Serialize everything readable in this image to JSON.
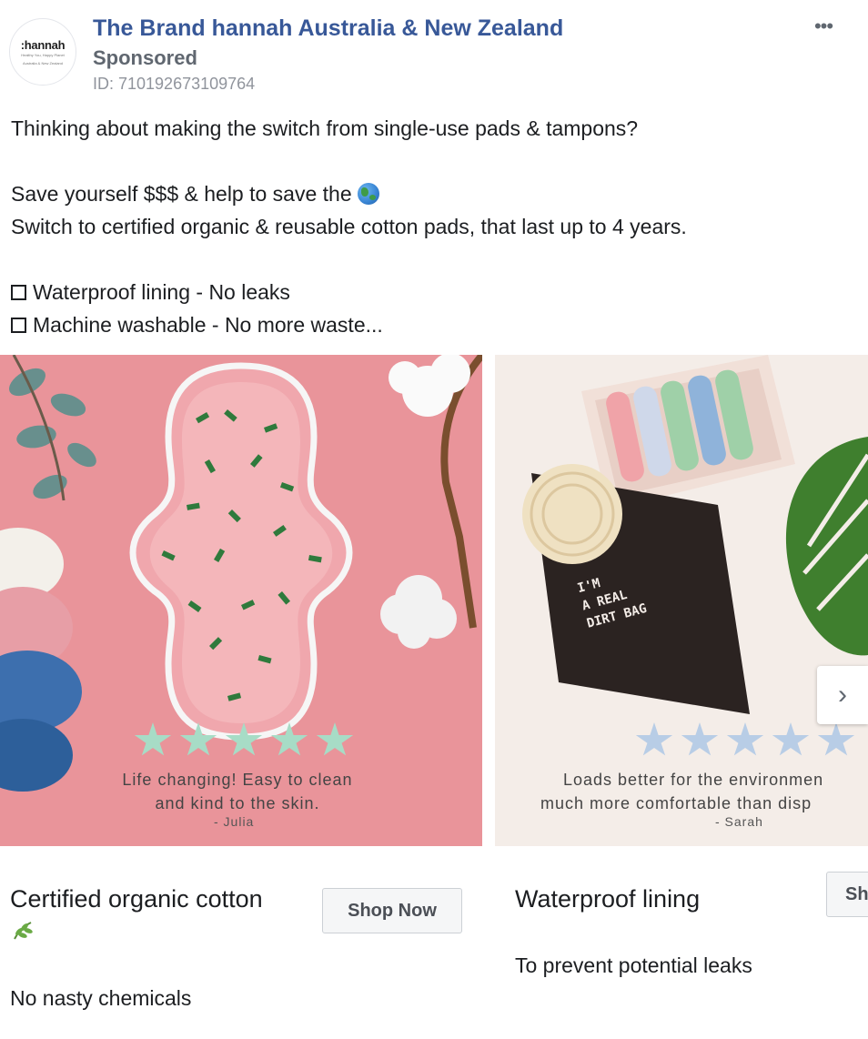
{
  "header": {
    "avatar_brand": ":hannah",
    "avatar_tagline": "Healthy You, Happy Planet",
    "avatar_region": "Australia & New Zealand",
    "page_name": "The Brand hannah Australia & New Zealand",
    "sponsored": "Sponsored",
    "ad_id": "ID: 710192673109764",
    "more_label": "•••"
  },
  "post": {
    "line1": "Thinking about making the switch from single-use pads & tampons?",
    "line2": "Save yourself $$$ & help to save the",
    "line2_icon": "globe-icon",
    "line3": "Switch to certified organic & reusable cotton pads, that last up to 4 years.",
    "bullet1": "Waterproof lining - No leaks",
    "bullet2": "Machine washable - No more waste..."
  },
  "carousel": {
    "cards": [
      {
        "quote_line1": "Life changing! Easy to clean",
        "quote_line2": "and kind to the skin.",
        "author": "- Julia",
        "rating": 5,
        "headline": "Certified organic cotton",
        "headline_icon": "leaf-icon",
        "description": "No nasty chemicals",
        "cta": "Shop Now"
      },
      {
        "quote_line1": "Loads better for the environmen",
        "quote_line2": "much more comfortable than disp",
        "author": "- Sarah",
        "rating": 5,
        "headline": "Waterproof lining",
        "description": "To prevent potential leaks",
        "cta": "Sh",
        "bag_text_1": "I'M",
        "bag_text_2": "A REAL",
        "bag_text_3": "DIRT BAG"
      }
    ],
    "next_label": "›"
  },
  "colors": {
    "page_name": "#385898",
    "card1_bg": "#e9949a",
    "card2_bg": "#f4ede8",
    "star_green": "#a7dcc6",
    "star_blue": "#b8cde6"
  }
}
